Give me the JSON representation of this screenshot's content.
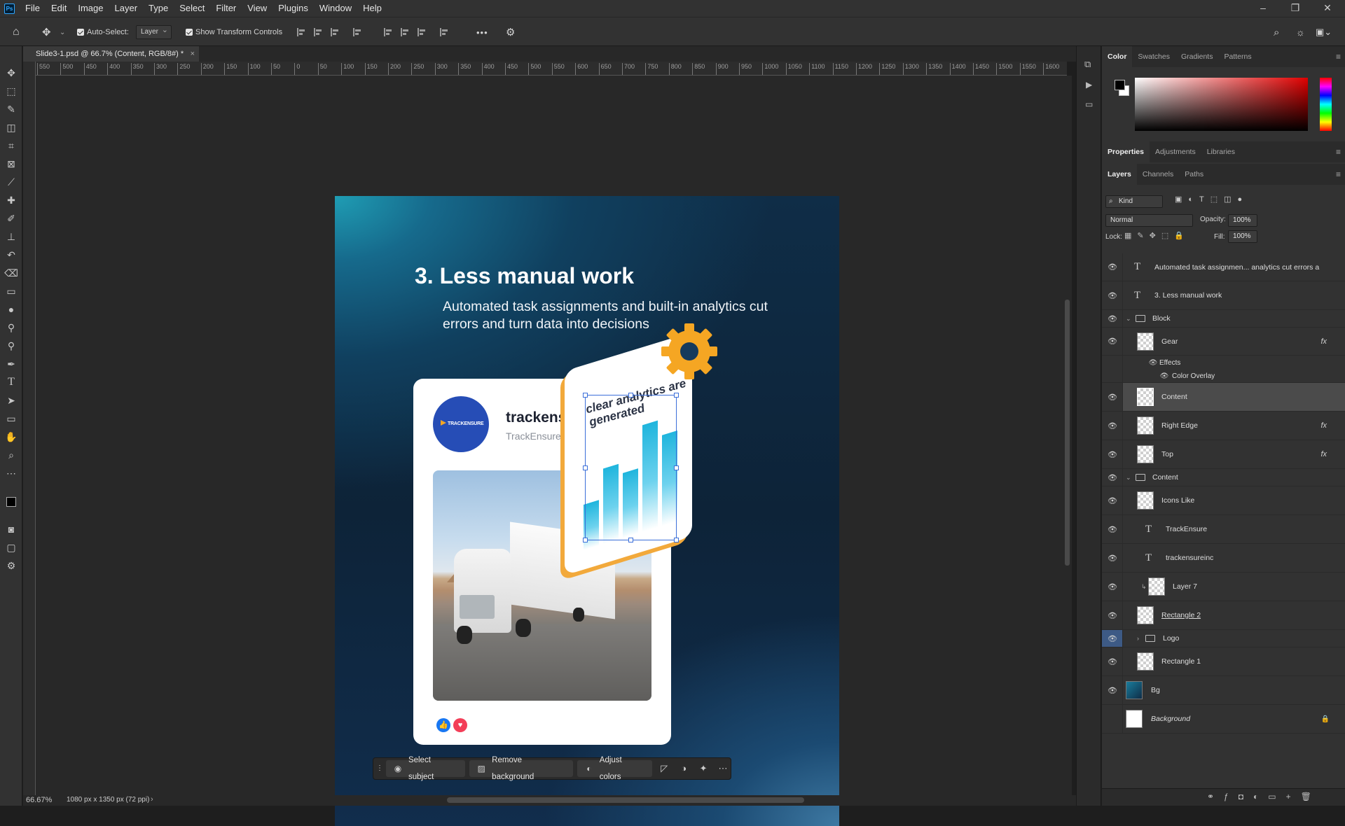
{
  "app": {
    "logo": "Ps",
    "menu": [
      "File",
      "Edit",
      "Image",
      "Layer",
      "Type",
      "Select",
      "Filter",
      "View",
      "Plugins",
      "Window",
      "Help"
    ],
    "window_controls": [
      "–",
      "❐",
      "✕"
    ]
  },
  "options_bar": {
    "auto_select_label": "Auto-Select:",
    "auto_select_target": "Layer",
    "show_transform_label": "Show Transform Controls",
    "more": "•••"
  },
  "document": {
    "tab_title": "Slide3-1.psd @ 66.7% (Content, RGB/8#) *",
    "ruler_labels": [
      "550",
      "500",
      "450",
      "400",
      "350",
      "300",
      "250",
      "200",
      "150",
      "100",
      "50",
      "0",
      "50",
      "100",
      "150",
      "200",
      "250",
      "300",
      "350",
      "400",
      "450",
      "500",
      "550",
      "600",
      "650",
      "700",
      "750",
      "800",
      "850",
      "900",
      "950",
      "1000",
      "1050",
      "1100",
      "1150",
      "1200",
      "1250",
      "1300",
      "1350",
      "1400",
      "1450",
      "1500",
      "1550",
      "1600"
    ]
  },
  "slide": {
    "title": "3. Less manual work",
    "subtitle": "Automated task assignments and built-in analytics cut errors and turn data into decisions",
    "post": {
      "username": "trackensureinc",
      "brand": "TrackEnsure",
      "avatar_logo": "TRACKENSURE"
    },
    "analytics_text": "clear analytics are generated",
    "chart_bars": [
      0.35,
      0.58,
      0.5,
      0.82,
      0.7
    ]
  },
  "context_bar": {
    "select_subject": "Select subject",
    "remove_background": "Remove background",
    "adjust_colors": "Adjust colors"
  },
  "status": {
    "zoom": "66.67%",
    "doc_info": "1080 px x 1350 px (72 ppi)"
  },
  "panels": {
    "color_tabs": [
      "Color",
      "Swatches",
      "Gradients",
      "Patterns"
    ],
    "properties_tabs": [
      "Properties",
      "Adjustments",
      "Libraries"
    ],
    "layers_tabs": [
      "Layers",
      "Channels",
      "Paths"
    ],
    "kind_label": "Kind",
    "blend_mode": "Normal",
    "opacity_label": "Opacity:",
    "opacity_value": "100%",
    "lock_label": "Lock:",
    "fill_label": "Fill:",
    "fill_value": "100%",
    "layers": [
      {
        "name": "Automated task assignmen... analytics cut errors a",
        "kind": "text",
        "indent": 0
      },
      {
        "name": "3. Less manual work",
        "kind": "text",
        "indent": 0
      },
      {
        "name": "Block",
        "kind": "group",
        "indent": 0
      },
      {
        "name": "Gear",
        "kind": "smart",
        "indent": 1,
        "fx": "fx"
      },
      {
        "name": "Effects",
        "kind": "effects",
        "indent": 2
      },
      {
        "name": "Color Overlay",
        "kind": "effect",
        "indent": 3
      },
      {
        "name": "Content",
        "kind": "smart",
        "indent": 1,
        "selected": true
      },
      {
        "name": "Right Edge",
        "kind": "smart",
        "indent": 1,
        "fx": "fx"
      },
      {
        "name": "Top",
        "kind": "smart",
        "indent": 1,
        "fx": "fx"
      },
      {
        "name": "Content",
        "kind": "group",
        "indent": 0
      },
      {
        "name": "Icons Like",
        "kind": "smart",
        "indent": 1
      },
      {
        "name": "TrackEnsure",
        "kind": "text",
        "indent": 1
      },
      {
        "name": "trackensureinc",
        "kind": "text",
        "indent": 1
      },
      {
        "name": "Layer 7",
        "kind": "smart",
        "indent": 2
      },
      {
        "name": "Rectangle 2",
        "kind": "smart",
        "indent": 1
      },
      {
        "name": "Logo",
        "kind": "group",
        "indent": 1
      },
      {
        "name": "Rectangle 1",
        "kind": "smart",
        "indent": 1
      },
      {
        "name": "Bg",
        "kind": "image",
        "indent": 0
      },
      {
        "name": "Background",
        "kind": "background",
        "indent": 0
      }
    ]
  }
}
